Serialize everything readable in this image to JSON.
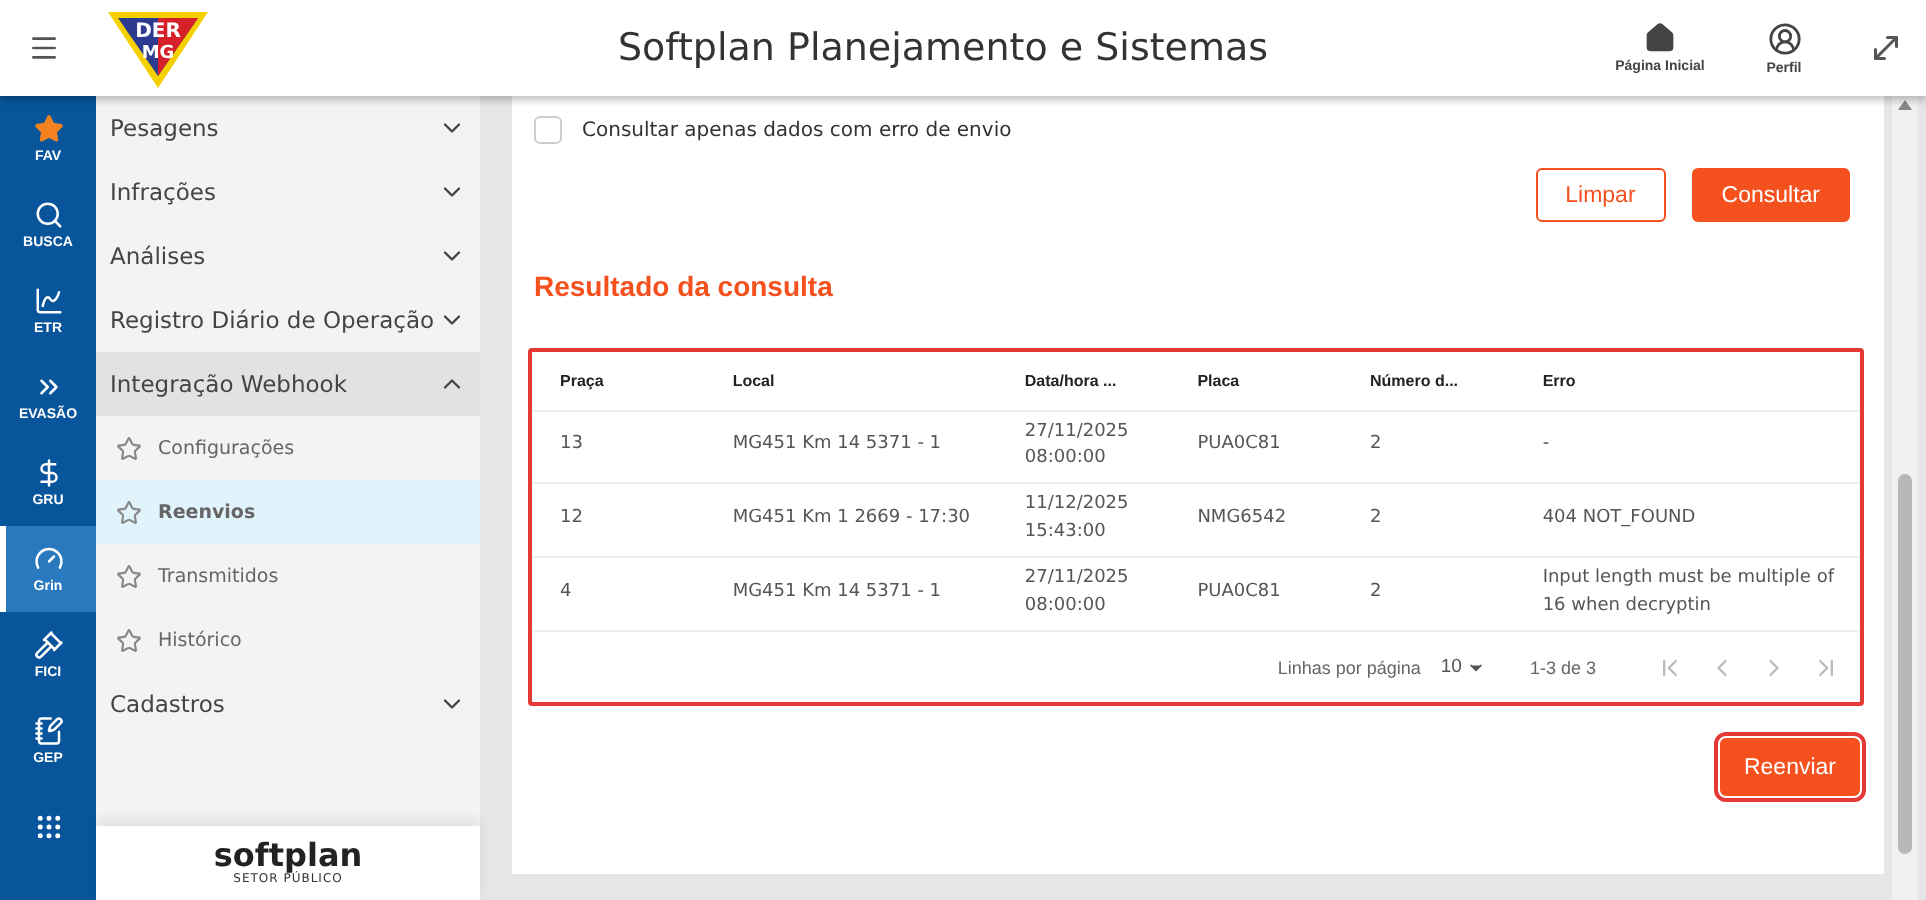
{
  "header": {
    "logo": {
      "line1": "DER",
      "line2": "MG"
    },
    "title": "Softplan Planejamento e Sistemas",
    "actions": [
      {
        "label": "Página Inicial"
      },
      {
        "label": "Perfil"
      }
    ]
  },
  "rail": {
    "items": [
      {
        "label": "FAV",
        "selected": false
      },
      {
        "label": "BUSCA",
        "selected": false
      },
      {
        "label": "ETR",
        "selected": false
      },
      {
        "label": "EVASÃO",
        "selected": false
      },
      {
        "label": "GRU",
        "selected": false
      },
      {
        "label": "Grin",
        "selected": true
      },
      {
        "label": "FICI",
        "selected": false
      },
      {
        "label": "GEP",
        "selected": false
      },
      {
        "selected": false
      }
    ]
  },
  "sidebar": {
    "items": [
      {
        "label": "Pesagens",
        "expanded": false
      },
      {
        "label": "Infrações",
        "expanded": false
      },
      {
        "label": "Análises",
        "expanded": false
      },
      {
        "label": "Registro Diário de Operação",
        "expanded": false
      },
      {
        "label": "Integração Webhook",
        "expanded": true,
        "children": [
          {
            "label": "Configurações",
            "selected": false
          },
          {
            "label": "Reenvios",
            "selected": true
          },
          {
            "label": "Transmitidos",
            "selected": false
          },
          {
            "label": "Histórico",
            "selected": false
          }
        ]
      },
      {
        "label": "Cadastros",
        "expanded": false
      }
    ],
    "footer": {
      "brand": "softplan",
      "subtitle": "SETOR PÚBLICO"
    }
  },
  "filter": {
    "checkbox": {
      "label": "Consultar apenas dados com erro de envio",
      "checked": false
    },
    "buttons": [
      {
        "label": "Limpar",
        "kind": "outline"
      },
      {
        "label": "Consultar",
        "kind": "primary"
      }
    ]
  },
  "result": {
    "title": "Resultado da consulta",
    "highlighted": true,
    "table": {
      "columns": [
        "Praça",
        "Local",
        "Data/hora ...",
        "Placa",
        "Número d...",
        "Erro"
      ],
      "rows": [
        [
          "13",
          "MG451 Km 14 5371 - 1",
          "27/11/2025 08:00:00",
          "PUA0C81",
          "2",
          "-"
        ],
        [
          "12",
          "MG451 Km 1 2669 - 17:30",
          "11/12/2025 15:43:00",
          "NMG6542",
          "2",
          "404 NOT_FOUND"
        ],
        [
          "4",
          "MG451 Km 14 5371 - 1",
          "27/11/2025 08:00:00",
          "PUA0C81",
          "2",
          "Input length must be multiple of 16 when decryptin"
        ]
      ]
    },
    "pagination": {
      "rows_label": "Linhas por página",
      "rows_value": "10",
      "range": "1-3 de 3",
      "nav": [
        {
          "disabled": true
        },
        {
          "disabled": true
        },
        {
          "disabled": true
        },
        {
          "disabled": true
        }
      ]
    }
  },
  "submit": {
    "label": "Reenviar",
    "highlighted": true
  }
}
